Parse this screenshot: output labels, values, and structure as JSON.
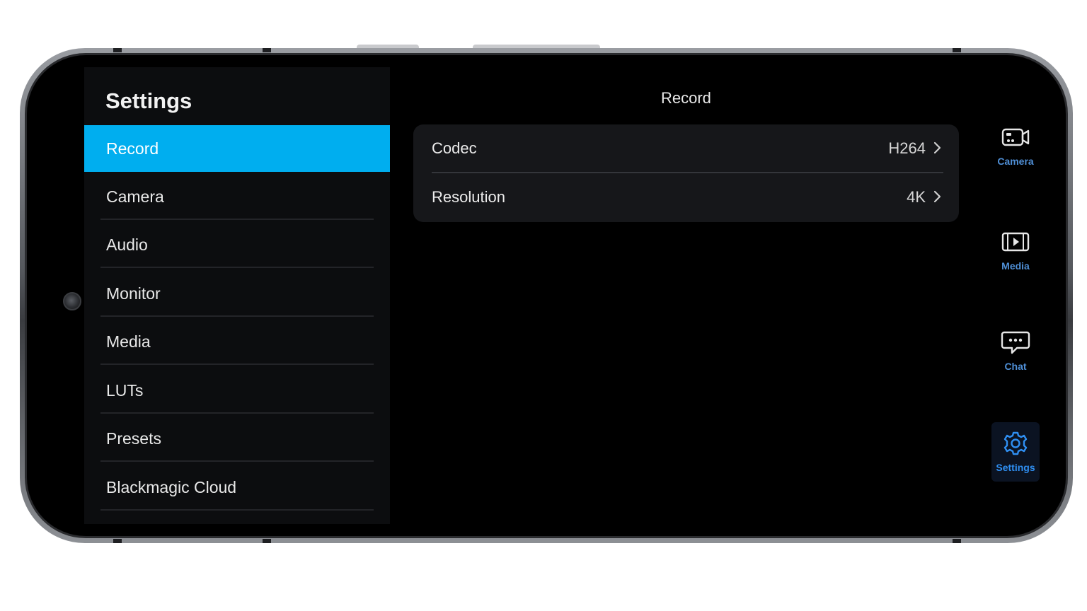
{
  "sidebar": {
    "title": "Settings",
    "items": [
      {
        "label": "Record",
        "active": true
      },
      {
        "label": "Camera",
        "active": false
      },
      {
        "label": "Audio",
        "active": false
      },
      {
        "label": "Monitor",
        "active": false
      },
      {
        "label": "Media",
        "active": false
      },
      {
        "label": "LUTs",
        "active": false
      },
      {
        "label": "Presets",
        "active": false
      },
      {
        "label": "Blackmagic Cloud",
        "active": false
      }
    ]
  },
  "content": {
    "title": "Record",
    "rows": [
      {
        "label": "Codec",
        "value": "H264"
      },
      {
        "label": "Resolution",
        "value": "4K"
      }
    ]
  },
  "rail": {
    "items": [
      {
        "label": "Camera",
        "icon": "camera-icon"
      },
      {
        "label": "Media",
        "icon": "media-icon"
      },
      {
        "label": "Chat",
        "icon": "chat-icon"
      },
      {
        "label": "Settings",
        "icon": "gear-icon",
        "active": true
      }
    ]
  },
  "colors": {
    "accent": "#00aeef",
    "rail_active": "#2f8ff2",
    "background": "#000000"
  }
}
